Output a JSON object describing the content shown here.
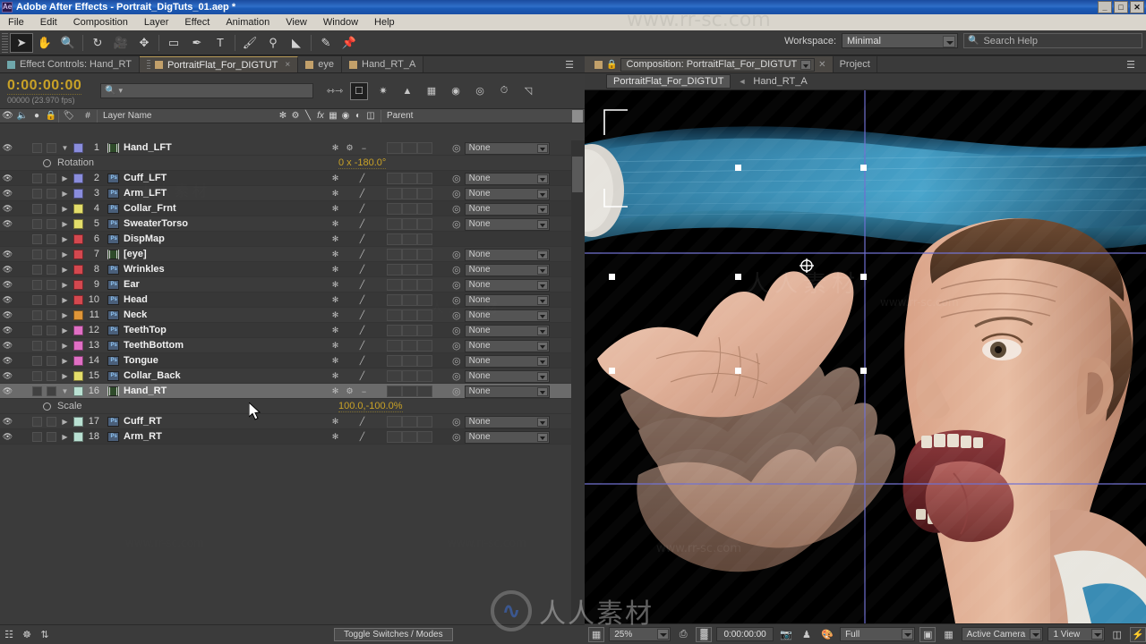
{
  "window": {
    "title": "Adobe After Effects - Portrait_DigTuts_01.aep *",
    "app_badge": "Ae",
    "minimize": "_",
    "maximize": "□",
    "close": "✕"
  },
  "menubar": {
    "items": [
      "File",
      "Edit",
      "Composition",
      "Layer",
      "Effect",
      "Animation",
      "View",
      "Window",
      "Help"
    ]
  },
  "toolbar": {
    "tools": [
      {
        "name": "selection-tool",
        "glyph": "➤",
        "selected": true
      },
      {
        "name": "hand-tool",
        "glyph": "✋",
        "selected": false
      },
      {
        "name": "zoom-tool",
        "glyph": "🔍",
        "selected": false
      },
      {
        "name": "rotation-tool",
        "glyph": "↻",
        "selected": false
      },
      {
        "name": "camera-tool",
        "glyph": "🎥",
        "selected": false
      },
      {
        "name": "pan-behind-tool",
        "glyph": "✥",
        "selected": false
      },
      {
        "name": "shape-tool",
        "glyph": "▭",
        "selected": false
      },
      {
        "name": "pen-tool",
        "glyph": "✒",
        "selected": false
      },
      {
        "name": "type-tool",
        "glyph": "T",
        "selected": false
      },
      {
        "name": "brush-tool",
        "glyph": "🖌",
        "selected": false
      },
      {
        "name": "clone-stamp-tool",
        "glyph": "⚲",
        "selected": false
      },
      {
        "name": "eraser-tool",
        "glyph": "◣",
        "selected": false
      },
      {
        "name": "roto-brush-tool",
        "glyph": "✎",
        "selected": false
      },
      {
        "name": "puppet-pin-tool",
        "glyph": "📌",
        "selected": false
      }
    ],
    "workspace_label": "Workspace:",
    "workspace_value": "Minimal",
    "search_help_placeholder": "Search Help"
  },
  "timeline": {
    "tabs": [
      {
        "label": "Effect Controls: Hand_RT",
        "active": false,
        "dot_color": "#6fa7ab",
        "closable": false
      },
      {
        "label": "PortraitFlat_For_DIGTUT",
        "active": true,
        "dot_color": "#c2a06a",
        "closable": true
      },
      {
        "label": "eye",
        "active": false,
        "dot_color": "#c2a06a",
        "closable": false
      },
      {
        "label": "Hand_RT_A",
        "active": false,
        "dot_color": "#c2a06a",
        "closable": false
      }
    ],
    "timecode": "0:00:00:00",
    "frames": "00000 (23.970 fps)",
    "search_placeholder": "",
    "header_columns": [
      "Layer Name",
      "Parent"
    ],
    "footer_button": "Toggle Switches / Modes",
    "column_icons": [
      "shy-icon",
      "collapse-icon",
      "quality-icon",
      "fx-icon",
      "frame-blend-icon",
      "motion-blur-icon",
      "adjustment-icon",
      "3d-layer-icon"
    ]
  },
  "layers": [
    {
      "index": "1",
      "name": "Hand_LFT",
      "label_color": "#8a8ddc",
      "type": "comp",
      "visible": true,
      "expanded": true,
      "selected": false,
      "parent": "None",
      "property": {
        "name": "Rotation",
        "value": "0 x -180.0°"
      }
    },
    {
      "index": "2",
      "name": "Cuff_LFT",
      "label_color": "#8a8ddc",
      "type": "ps",
      "visible": true,
      "expanded": false,
      "selected": false,
      "parent": "None"
    },
    {
      "index": "3",
      "name": "Arm_LFT",
      "label_color": "#8a8ddc",
      "type": "ps",
      "visible": true,
      "expanded": false,
      "selected": false,
      "parent": "None"
    },
    {
      "index": "4",
      "name": "Collar_Frnt",
      "label_color": "#e3dd6a",
      "type": "ps",
      "visible": true,
      "expanded": false,
      "selected": false,
      "parent": "None"
    },
    {
      "index": "5",
      "name": "SweaterTorso",
      "label_color": "#e3dd6a",
      "type": "ps",
      "visible": true,
      "expanded": false,
      "selected": false,
      "parent": "None"
    },
    {
      "index": "6",
      "name": "DispMap",
      "label_color": "#d4484f",
      "type": "ps",
      "visible": false,
      "expanded": false,
      "selected": false,
      "parent": ""
    },
    {
      "index": "7",
      "name": "[eye]",
      "label_color": "#d4484f",
      "type": "comp",
      "visible": true,
      "expanded": false,
      "selected": false,
      "parent": "None"
    },
    {
      "index": "8",
      "name": "Wrinkles",
      "label_color": "#d4484f",
      "type": "ps",
      "visible": true,
      "expanded": false,
      "selected": false,
      "parent": "None"
    },
    {
      "index": "9",
      "name": "Ear",
      "label_color": "#d4484f",
      "type": "ps",
      "visible": true,
      "expanded": false,
      "selected": false,
      "parent": "None"
    },
    {
      "index": "10",
      "name": "Head",
      "label_color": "#d4484f",
      "type": "ps",
      "visible": true,
      "expanded": false,
      "selected": false,
      "parent": "None"
    },
    {
      "index": "11",
      "name": "Neck",
      "label_color": "#e09638",
      "type": "ps",
      "visible": true,
      "expanded": false,
      "selected": false,
      "parent": "None"
    },
    {
      "index": "12",
      "name": "TeethTop",
      "label_color": "#e06fc4",
      "type": "ps",
      "visible": true,
      "expanded": false,
      "selected": false,
      "parent": "None"
    },
    {
      "index": "13",
      "name": "TeethBottom",
      "label_color": "#e06fc4",
      "type": "ps",
      "visible": true,
      "expanded": false,
      "selected": false,
      "parent": "None"
    },
    {
      "index": "14",
      "name": "Tongue",
      "label_color": "#e06fc4",
      "type": "ps",
      "visible": true,
      "expanded": false,
      "selected": false,
      "parent": "None"
    },
    {
      "index": "15",
      "name": "Collar_Back",
      "label_color": "#e3dd6a",
      "type": "ps",
      "visible": true,
      "expanded": false,
      "selected": false,
      "parent": "None"
    },
    {
      "index": "16",
      "name": "Hand_RT",
      "label_color": "#b9e0d2",
      "type": "comp",
      "visible": true,
      "expanded": true,
      "selected": true,
      "parent": "None",
      "property": {
        "name": "Scale",
        "value": "100.0,-100.0%"
      }
    },
    {
      "index": "17",
      "name": "Cuff_RT",
      "label_color": "#b9e0d2",
      "type": "ps",
      "visible": true,
      "expanded": false,
      "selected": false,
      "parent": "None"
    },
    {
      "index": "18",
      "name": "Arm_RT",
      "label_color": "#b9e0d2",
      "type": "ps",
      "visible": true,
      "expanded": false,
      "selected": false,
      "parent": "None"
    }
  ],
  "composition": {
    "tabs": [
      {
        "label": "Composition: PortraitFlat_For_DIGTUT",
        "active": true
      },
      {
        "label": "Project",
        "active": false
      }
    ],
    "close_glyph": "✕",
    "breadcrumb": {
      "root": "PortraitFlat_For_DIGTUT",
      "separator": "◄",
      "current": "Hand_RT_A"
    },
    "footer": {
      "zoom": "25%",
      "time": "0:00:00:00",
      "resolution": "Full",
      "view_camera": "Active Camera",
      "view_count": "1 View"
    }
  },
  "watermarks": {
    "url": "www.rr-sc.com",
    "cn": "人人素材",
    "cn_short": "人人素材"
  },
  "colors": {
    "accent_yellow": "#c9a227",
    "panel_bg": "#3b3b3b",
    "titlebar_blue": "#2f6ec8",
    "selection": "#6b6b6b"
  }
}
